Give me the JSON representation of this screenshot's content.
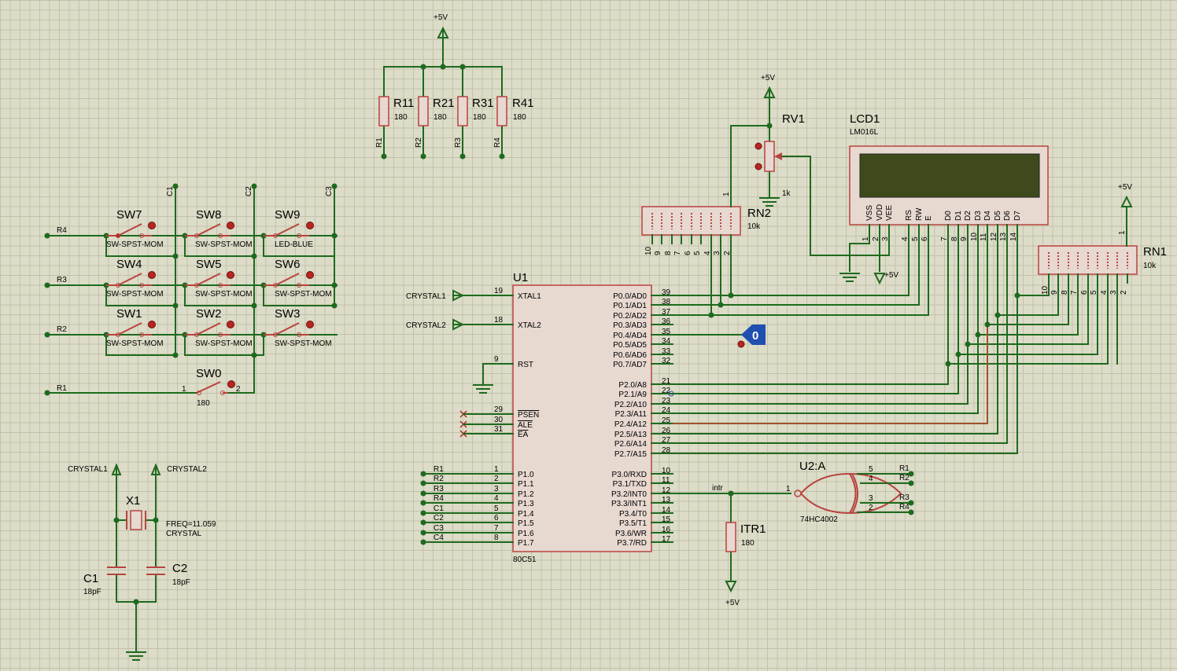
{
  "power": {
    "vcc": "+5V"
  },
  "resistor_bank": [
    {
      "ref": "R11",
      "value": "180",
      "net": "R1"
    },
    {
      "ref": "R21",
      "value": "180",
      "net": "R2"
    },
    {
      "ref": "R31",
      "value": "180",
      "net": "R3"
    },
    {
      "ref": "R41",
      "value": "180",
      "net": "R4"
    }
  ],
  "keypad": {
    "rows": [
      "R4",
      "R3",
      "R2"
    ],
    "cols": [
      "C1",
      "C2",
      "C3"
    ],
    "switches": [
      {
        "ref": "SW7",
        "type": "SW-SPST-MOM"
      },
      {
        "ref": "SW8",
        "type": "SW-SPST-MOM"
      },
      {
        "ref": "SW9",
        "type": "LED-BLUE"
      },
      {
        "ref": "SW4",
        "type": "SW-SPST-MOM"
      },
      {
        "ref": "SW5",
        "type": "SW-SPST-MOM"
      },
      {
        "ref": "SW6",
        "type": "SW-SPST-MOM"
      },
      {
        "ref": "SW1",
        "type": "SW-SPST-MOM"
      },
      {
        "ref": "SW2",
        "type": "SW-SPST-MOM"
      },
      {
        "ref": "SW3",
        "type": "SW-SPST-MOM"
      }
    ],
    "sw0": {
      "ref": "SW0",
      "value": "180",
      "net": "R1",
      "pin1": "1",
      "pin2": "2"
    }
  },
  "crystal": {
    "net1": "CRYSTAL1",
    "net2": "CRYSTAL2",
    "ref": "X1",
    "freq": "FREQ=11.059",
    "type": "CRYSTAL",
    "c1": {
      "ref": "C1",
      "value": "18pF"
    },
    "c2": {
      "ref": "C2",
      "value": "18pF"
    }
  },
  "mcu": {
    "ref": "U1",
    "part": "80C51",
    "left_pins": [
      {
        "num": "19",
        "name": "XTAL1",
        "net": "CRYSTAL1"
      },
      {
        "num": "18",
        "name": "XTAL2",
        "net": "CRYSTAL2"
      },
      {
        "num": "9",
        "name": "RST"
      },
      {
        "num": "29",
        "name": "PSEN"
      },
      {
        "num": "30",
        "name": "ALE"
      },
      {
        "num": "31",
        "name": "EA"
      },
      {
        "num": "1",
        "name": "P1.0",
        "net": "R1"
      },
      {
        "num": "2",
        "name": "P1.1",
        "net": "R2"
      },
      {
        "num": "3",
        "name": "P1.2",
        "net": "R3"
      },
      {
        "num": "4",
        "name": "P1.3",
        "net": "R4"
      },
      {
        "num": "5",
        "name": "P1.4",
        "net": "C1"
      },
      {
        "num": "6",
        "name": "P1.5",
        "net": "C2"
      },
      {
        "num": "7",
        "name": "P1.6",
        "net": "C3"
      },
      {
        "num": "8",
        "name": "P1.7",
        "net": "C4"
      }
    ],
    "right_pins": [
      {
        "num": "39",
        "name": "P0.0/AD0"
      },
      {
        "num": "38",
        "name": "P0.1/AD1"
      },
      {
        "num": "37",
        "name": "P0.2/AD2"
      },
      {
        "num": "36",
        "name": "P0.3/AD3"
      },
      {
        "num": "35",
        "name": "P0.4/AD4"
      },
      {
        "num": "34",
        "name": "P0.5/AD5"
      },
      {
        "num": "33",
        "name": "P0.6/AD6"
      },
      {
        "num": "32",
        "name": "P0.7/AD7"
      },
      {
        "num": "21",
        "name": "P2.0/A8"
      },
      {
        "num": "22",
        "name": "P2.1/A9"
      },
      {
        "num": "23",
        "name": "P2.2/A10"
      },
      {
        "num": "24",
        "name": "P2.3/A11"
      },
      {
        "num": "25",
        "name": "P2.4/A12"
      },
      {
        "num": "26",
        "name": "P2.5/A13"
      },
      {
        "num": "27",
        "name": "P2.6/A14"
      },
      {
        "num": "28",
        "name": "P2.7/A15"
      },
      {
        "num": "10",
        "name": "P3.0/RXD"
      },
      {
        "num": "11",
        "name": "P3.1/TXD"
      },
      {
        "num": "12",
        "name": "P3.2/INT0"
      },
      {
        "num": "13",
        "name": "P3.3/INT1"
      },
      {
        "num": "14",
        "name": "P3.4/T0"
      },
      {
        "num": "15",
        "name": "P3.5/T1"
      },
      {
        "num": "16",
        "name": "P3.6/WR"
      },
      {
        "num": "17",
        "name": "P3.7/RD"
      }
    ]
  },
  "probe": {
    "value": "0"
  },
  "intr": {
    "net": "intr",
    "ref": "ITR1",
    "value": "180"
  },
  "nor_gate": {
    "ref": "U2:A",
    "part": "74HC4002",
    "out_pin": "1",
    "inputs": [
      {
        "pin": "5",
        "net": "R1"
      },
      {
        "pin": "4",
        "net": "R2"
      },
      {
        "pin": "3",
        "net": "R3"
      },
      {
        "pin": "2",
        "net": "R4"
      }
    ]
  },
  "pot": {
    "ref": "RV1",
    "value": "1k",
    "pin": "1"
  },
  "lcd": {
    "ref": "LCD1",
    "part": "LM016L",
    "pins": [
      {
        "name": "VSS",
        "num": "1"
      },
      {
        "name": "VDD",
        "num": "2"
      },
      {
        "name": "VEE",
        "num": "3"
      },
      {
        "name": "RS",
        "num": "4"
      },
      {
        "name": "RW",
        "num": "5"
      },
      {
        "name": "E",
        "num": "6"
      },
      {
        "name": "D0",
        "num": "7"
      },
      {
        "name": "D1",
        "num": "8"
      },
      {
        "name": "D2",
        "num": "9"
      },
      {
        "name": "D3",
        "num": "10"
      },
      {
        "name": "D4",
        "num": "11"
      },
      {
        "name": "D5",
        "num": "12"
      },
      {
        "name": "D6",
        "num": "13"
      },
      {
        "name": "D7",
        "num": "14"
      }
    ],
    "lcd_color": "#3f4a1c"
  },
  "rn2": {
    "ref": "RN2",
    "value": "10k",
    "pins": [
      "10",
      "9",
      "8",
      "7",
      "6",
      "5",
      "4",
      "3",
      "2"
    ],
    "common": "1"
  },
  "rn1": {
    "ref": "RN1",
    "value": "10k",
    "pins": [
      "10",
      "9",
      "8",
      "7",
      "6",
      "5",
      "4",
      "3",
      "2"
    ],
    "common": "1"
  },
  "col_labels": [
    "C1",
    "C2",
    "C3"
  ]
}
